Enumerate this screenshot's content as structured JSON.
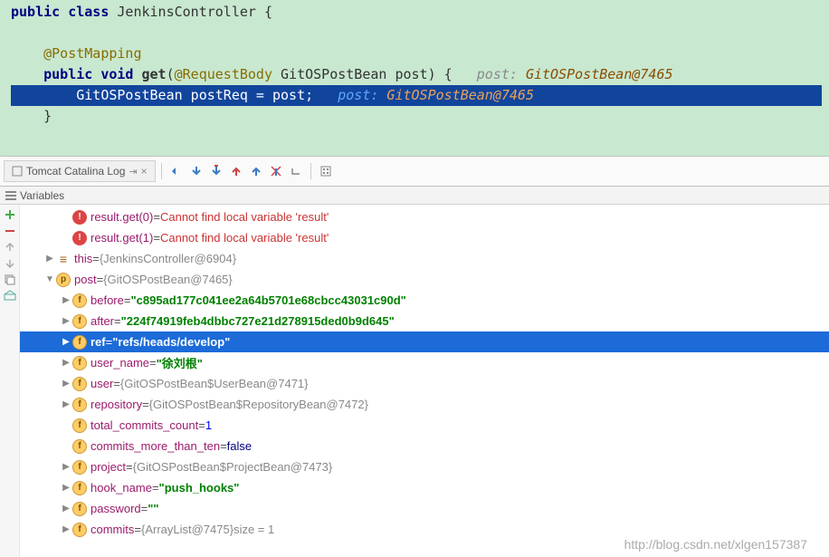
{
  "editor": {
    "lines": [
      {
        "segments": [
          {
            "t": "public ",
            "c": "kw-public"
          },
          {
            "t": "class ",
            "c": "kw-class"
          },
          {
            "t": "JenkinsController ",
            "c": "classname"
          },
          {
            "t": "{",
            "c": "punct"
          }
        ]
      },
      {
        "segments": []
      },
      {
        "segments": [
          {
            "t": "    @PostMapping",
            "c": "annotation"
          }
        ]
      },
      {
        "segments": [
          {
            "t": "    ",
            "c": ""
          },
          {
            "t": "public ",
            "c": "kw-public"
          },
          {
            "t": "void ",
            "c": "kw-void"
          },
          {
            "t": "get",
            "c": "method"
          },
          {
            "t": "(",
            "c": "punct"
          },
          {
            "t": "@RequestBody ",
            "c": "annotation"
          },
          {
            "t": "GitOSPostBean ",
            "c": "classname"
          },
          {
            "t": "post",
            "c": "classname"
          },
          {
            "t": ") {   ",
            "c": "punct"
          },
          {
            "t": "post: ",
            "c": "param-hint"
          },
          {
            "t": "GitOSPostBean@7465",
            "c": "param-hint-val"
          }
        ]
      },
      {
        "hl": true,
        "segments": [
          {
            "t": "        GitOSPostBean postReq = post;   ",
            "c": "classname"
          },
          {
            "t": "post: ",
            "c": "param-hint"
          },
          {
            "t": "GitOSPostBean@7465",
            "c": "param-hint-val"
          }
        ]
      },
      {
        "segments": [
          {
            "t": "    }",
            "c": "punct"
          }
        ]
      }
    ]
  },
  "tab": {
    "label": "Tomcat Catalina Log"
  },
  "panel": {
    "title": "Variables"
  },
  "tree": [
    {
      "indent": 1,
      "arrow": "",
      "badge": "err",
      "name": "result.get(0)",
      "eq": " = ",
      "valClass": "var-err",
      "val": "Cannot find local variable 'result'"
    },
    {
      "indent": 1,
      "arrow": "",
      "badge": "err",
      "name": "result.get(1)",
      "eq": " = ",
      "valClass": "var-err",
      "val": "Cannot find local variable 'result'"
    },
    {
      "indent": 0,
      "arrow": "▶",
      "badge": "lines",
      "name": "this",
      "eq": " = ",
      "valClass": "var-obj",
      "val": "{JenkinsController@6904}"
    },
    {
      "indent": 0,
      "arrow": "▼",
      "badge": "p",
      "name": "post",
      "eq": " = ",
      "valClass": "var-obj",
      "val": "{GitOSPostBean@7465}"
    },
    {
      "indent": 1,
      "arrow": "▶",
      "badge": "f",
      "name": "before",
      "eq": " = ",
      "valClass": "var-str",
      "val": "\"c895ad177c041ee2a64b5701e68cbcc43031c90d\""
    },
    {
      "indent": 1,
      "arrow": "▶",
      "badge": "f",
      "name": "after",
      "eq": " = ",
      "valClass": "var-str",
      "val": "\"224f74919feb4dbbc727e21d278915ded0b9d645\""
    },
    {
      "indent": 1,
      "arrow": "▶",
      "badge": "f",
      "name": "ref",
      "eq": " = ",
      "valClass": "var-str",
      "val": "\"refs/heads/develop\"",
      "sel": true
    },
    {
      "indent": 1,
      "arrow": "▶",
      "badge": "f",
      "name": "user_name",
      "eq": " = ",
      "valClass": "var-str",
      "val": "\"徐刘根\""
    },
    {
      "indent": 1,
      "arrow": "▶",
      "badge": "f",
      "name": "user",
      "eq": " = ",
      "valClass": "var-obj",
      "val": "{GitOSPostBean$UserBean@7471}"
    },
    {
      "indent": 1,
      "arrow": "▶",
      "badge": "f",
      "name": "repository",
      "eq": " = ",
      "valClass": "var-obj",
      "val": "{GitOSPostBean$RepositoryBean@7472}"
    },
    {
      "indent": 1,
      "arrow": "",
      "badge": "f",
      "name": "total_commits_count",
      "eq": " = ",
      "valClass": "var-num",
      "val": "1"
    },
    {
      "indent": 1,
      "arrow": "",
      "badge": "f",
      "name": "commits_more_than_ten",
      "eq": " = ",
      "valClass": "var-bool",
      "val": "false"
    },
    {
      "indent": 1,
      "arrow": "▶",
      "badge": "f",
      "name": "project",
      "eq": " = ",
      "valClass": "var-obj",
      "val": "{GitOSPostBean$ProjectBean@7473}"
    },
    {
      "indent": 1,
      "arrow": "▶",
      "badge": "f",
      "name": "hook_name",
      "eq": " = ",
      "valClass": "var-str",
      "val": "\"push_hooks\""
    },
    {
      "indent": 1,
      "arrow": "▶",
      "badge": "f",
      "name": "password",
      "eq": " = ",
      "valClass": "var-str",
      "val": "\"\""
    },
    {
      "indent": 1,
      "arrow": "▶",
      "badge": "f",
      "name": "commits",
      "eq": " = ",
      "valClass": "var-obj",
      "val": "{ArrayList@7475}",
      "extra": "  size = 1"
    }
  ],
  "watermark": "http://blog.csdn.net/xlgen157387"
}
